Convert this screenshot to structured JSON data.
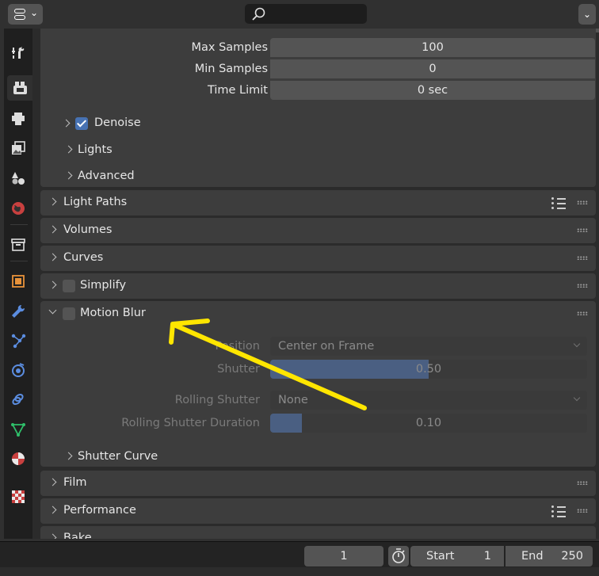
{
  "header": {
    "editor_type_icon": "editor-type-icon",
    "search_placeholder": ""
  },
  "tabs": [
    {
      "name": "tool-tab",
      "icon": "tool-icon"
    },
    {
      "name": "render-tab",
      "icon": "render-icon",
      "active": true
    },
    {
      "name": "output-tab",
      "icon": "printer-icon"
    },
    {
      "name": "view-layer-tab",
      "icon": "image-stack-icon"
    },
    {
      "name": "scene-tab",
      "icon": "scene-icon"
    },
    {
      "name": "world-tab",
      "icon": "world-icon"
    },
    {
      "name": "collection-tab",
      "icon": "collection-icon"
    },
    {
      "name": "object-tab",
      "icon": "object-icon"
    },
    {
      "name": "modifier-tab",
      "icon": "wrench-icon"
    },
    {
      "name": "particles-tab",
      "icon": "particles-icon"
    },
    {
      "name": "physics-tab",
      "icon": "physics-icon"
    },
    {
      "name": "constraints-tab",
      "icon": "constraint-icon"
    },
    {
      "name": "data-tab",
      "icon": "mesh-data-icon"
    },
    {
      "name": "material-tab",
      "icon": "material-icon"
    },
    {
      "name": "texture-tab",
      "icon": "texture-icon"
    }
  ],
  "sampling": {
    "max_samples_label": "Max Samples",
    "max_samples_value": "100",
    "min_samples_label": "Min Samples",
    "min_samples_value": "0",
    "time_limit_label": "Time Limit",
    "time_limit_value": "0 sec",
    "denoise_label": "Denoise",
    "denoise_checked": true,
    "lights_label": "Lights",
    "advanced_label": "Advanced"
  },
  "panels": {
    "light_paths": "Light Paths",
    "volumes": "Volumes",
    "curves": "Curves",
    "simplify": "Simplify",
    "motion_blur": "Motion Blur",
    "film": "Film",
    "performance": "Performance",
    "bake": "Bake"
  },
  "motion_blur": {
    "enabled": false,
    "position_label": "Position",
    "position_value": "Center on Frame",
    "shutter_label": "Shutter",
    "shutter_value": "0.50",
    "shutter_fraction": 0.5,
    "rolling_shutter_label": "Rolling Shutter",
    "rolling_shutter_value": "None",
    "rolling_duration_label": "Rolling Shutter Duration",
    "rolling_duration_value": "0.10",
    "rolling_duration_fraction": 0.1,
    "shutter_curve_label": "Shutter Curve"
  },
  "timeline": {
    "current_frame": "1",
    "start_label": "Start",
    "start_value": "1",
    "end_label": "End",
    "end_value": "250"
  },
  "colors": {
    "accent": "#4772b3",
    "annotation_arrow": "#ffe600"
  }
}
